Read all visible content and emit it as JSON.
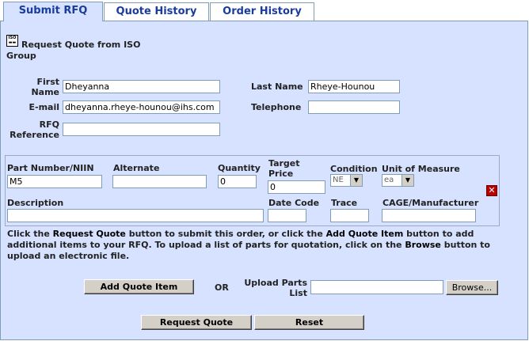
{
  "tabs": [
    "Submit RFQ",
    "Quote History",
    "Order History"
  ],
  "heading": {
    "icon_text": "ISO",
    "line1": "Request Quote from ISO",
    "line2": "Group"
  },
  "contact": {
    "first_name_label_1": "First",
    "first_name_label_2": "Name",
    "first_name_value": "Dheyanna",
    "last_name_label": "Last Name",
    "last_name_value": "Rheye-Hounou",
    "email_label": "E-mail",
    "email_value": "dheyanna.rheye-hounou@ihs.com",
    "telephone_label": "Telephone",
    "telephone_value": "",
    "rfq_label_1": "RFQ",
    "rfq_label_2": "Reference",
    "rfq_value": ""
  },
  "item": {
    "part_label": "Part Number/NIIN",
    "part_value": "M5",
    "alternate_label": "Alternate",
    "alternate_value": "",
    "quantity_label": "Quantity",
    "quantity_value": "0",
    "target_label_1": "Target",
    "target_label_2": "Price",
    "target_value": "0",
    "condition_label": "Condition",
    "condition_value": "NE",
    "uom_label": "Unit of Measure",
    "uom_value": "ea",
    "description_label": "Description",
    "description_value": "",
    "date_code_label": "Date Code",
    "date_code_value": "",
    "trace_label": "Trace",
    "trace_value": "",
    "cage_label": "CAGE/Manufacturer",
    "cage_value": "",
    "delete_icon": "close-icon"
  },
  "instructions": {
    "p1": "Click the ",
    "b1": "Request Quote",
    "p2": " button to submit this order, or click the ",
    "b2": "Add Quote Item",
    "p3": " button to add additional items to your RFQ. To upload a list of parts for quotation, click on the ",
    "b3": "Browse",
    "p4": " button to upload an electronic file."
  },
  "actions": {
    "add_item": "Add Quote Item",
    "or": "OR",
    "upload_label_1": "Upload Parts",
    "upload_label_2": "List",
    "upload_value": "",
    "browse": "Browse...",
    "request_quote": "Request Quote",
    "reset": "Reset"
  }
}
